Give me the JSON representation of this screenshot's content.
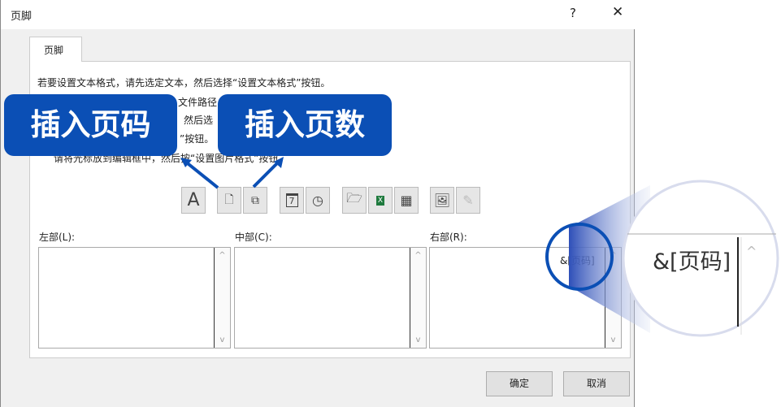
{
  "dialog": {
    "title": "页脚",
    "help": "?",
    "close": "✕",
    "tab": "页脚"
  },
  "instructions": [
    "若要设置文本格式，请先选定文本，然后选择“设置文本格式”按钮。",
    "文件路径",
    "然后选",
    "”按钮。",
    "请将光标放到编辑框中，然后按“设置图片格式”按钮。"
  ],
  "toolbar": [
    "format-text",
    "insert-page-number",
    "insert-page-count",
    "insert-date",
    "insert-time",
    "insert-file-path",
    "insert-file-name",
    "insert-sheet-name",
    "insert-picture",
    "format-picture"
  ],
  "toolbar_glyphs": {
    "format_text": "A",
    "date": "7"
  },
  "sections": {
    "left": "左部(L):",
    "center": "中部(C):",
    "right": "右部(R):",
    "right_value": "&[页码]"
  },
  "buttons": {
    "ok": "确定",
    "cancel": "取消"
  },
  "callouts": {
    "page_number": "插入页码",
    "page_count": "插入页数"
  },
  "magnifier": {
    "text": "&[页码]"
  },
  "colors": {
    "accent": "#0b4fb5"
  }
}
